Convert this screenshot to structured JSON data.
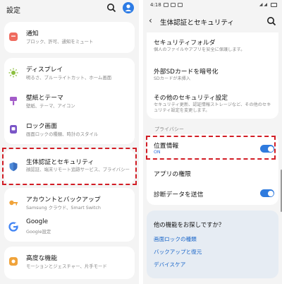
{
  "left": {
    "title": "設定",
    "icons": {
      "search": "search-icon",
      "avatar": "account-avatar-icon"
    },
    "items": [
      {
        "label": "通知",
        "sub": "ブロック、許可、通知をミュート",
        "icon": "bell-icon",
        "color": "#ef6b5f"
      },
      {
        "label": "ディスプレイ",
        "sub": "明るさ、ブルーライトカット、ホーム画面",
        "icon": "sun-icon",
        "color": "#8cbf3f"
      },
      {
        "label": "壁紙とテーマ",
        "sub": "壁紙、テーマ、アイコン",
        "icon": "brush-icon",
        "color": "#a35cc9"
      },
      {
        "label": "ロック画面",
        "sub": "画面ロックの種類、時計のスタイル",
        "icon": "lock-icon",
        "color": "#7a55c7"
      },
      {
        "label": "生体認証とセキュリティ",
        "sub": "顔認証、端末リモート追跡サービス、プライバシー",
        "icon": "shield-icon",
        "color": "#4f8ad8"
      },
      {
        "label": "アカウントとバックアップ",
        "sub": "Samsung クラウド、Smart Switch",
        "icon": "key-icon",
        "color": "#f0a33a"
      },
      {
        "label": "Google",
        "sub": "Google設定",
        "icon": "google-icon",
        "color": "#4285f4"
      },
      {
        "label": "高度な機能",
        "sub": "モーションとジェスチャー、片手モード",
        "icon": "gear-icon",
        "color": "#f0a33a"
      }
    ]
  },
  "right": {
    "status": {
      "time": "4:18"
    },
    "title": "生体認証とセキュリティ",
    "icons": {
      "back": "back-arrow-icon",
      "search": "search-icon"
    },
    "items_top": [
      {
        "label": "セキュリティフォルダ",
        "sub": "個人のファイルやアプリを安全に保護します。"
      },
      {
        "label": "外部SDカードを暗号化",
        "sub": "SDカードが未挿入"
      },
      {
        "label": "その他のセキュリティ設定",
        "sub": "セキュリティ更新、認証情報ストレージなど、その他のセキュリティ設定を変更します。"
      }
    ],
    "privacy_label": "プライバシー",
    "location": {
      "label": "位置情報",
      "state": "ON",
      "toggle_on": true
    },
    "app_permissions": "アプリの権限",
    "diagnostics": {
      "label": "診断データを送信",
      "toggle_on": true
    },
    "suggest": {
      "title": "他の機能をお探しですか？",
      "links": [
        "画面ロックの種類",
        "バックアップと復元",
        "デバイスケア"
      ]
    }
  },
  "colors": {
    "accent_blue": "#2f7bde",
    "highlight_red": "#d21d25"
  }
}
